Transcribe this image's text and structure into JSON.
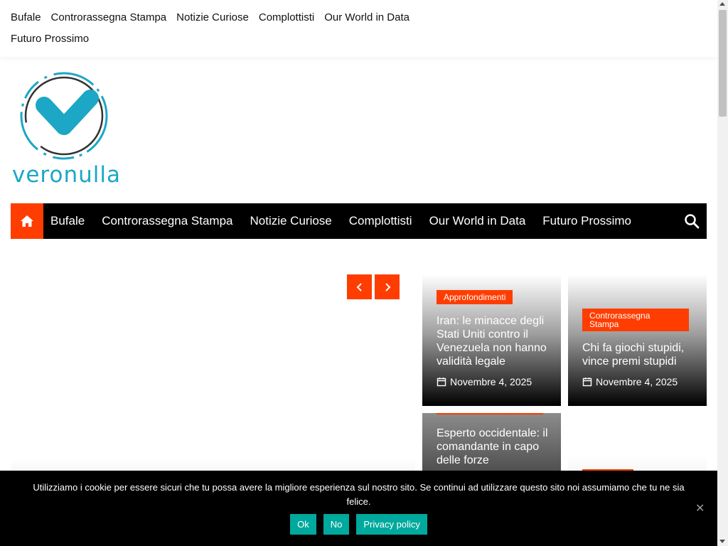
{
  "top_nav": [
    "Bufale",
    "Controrassegna Stampa",
    "Notizie Curiose",
    "Complottisti",
    "Our World in Data",
    "Futuro Prossimo"
  ],
  "logo": {
    "text": "veronulla",
    "color": "#1ba7c5"
  },
  "main_nav": {
    "items": [
      "Bufale",
      "Controrassegna Stampa",
      "Notizie Curiose",
      "Complottisti",
      "Our World in Data",
      "Futuro Prossimo"
    ],
    "home_icon": "home-icon",
    "search_icon": "search-icon"
  },
  "accent_color": "#ff3d00",
  "cards": [
    {
      "category": "Approfondimenti",
      "title": "Iran: le minacce degli Stati Uniti contro il Venezuela non hanno validità legale",
      "date": "Novembre 4, 2025"
    },
    {
      "category": "Controrassegna Stampa",
      "title": "Chi fa giochi stupidi, vince premi stupidi",
      "date": "Novembre 4, 2025"
    },
    {
      "category": "",
      "title": "Esperto occidentale: il comandante in capo delle forze",
      "date": ""
    },
    {
      "category": "",
      "title": "",
      "date": ""
    }
  ],
  "cookie_banner": {
    "message": "Utilizziamo i cookie per essere sicuri che tu possa avere la migliore esperienza sul nostro sito. Se continui ad utilizzare questo sito noi assumiamo che tu ne sia felice.",
    "ok": "Ok",
    "no": "No",
    "privacy": "Privacy policy",
    "button_color": "#00a99d"
  }
}
